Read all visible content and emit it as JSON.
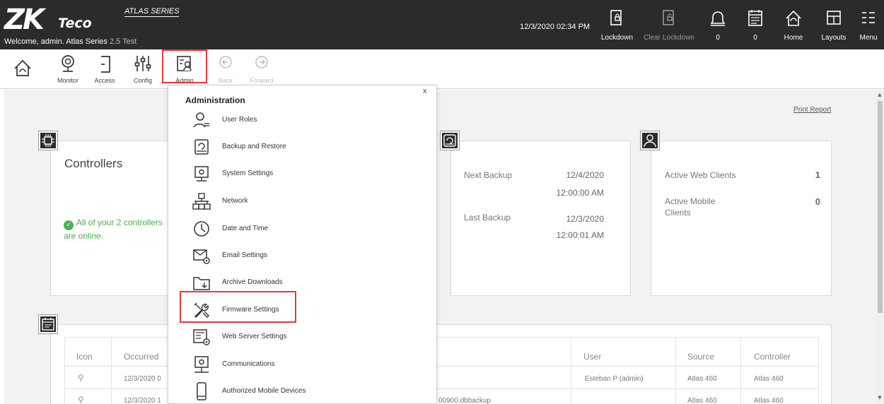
{
  "header": {
    "logo_main": "ZK",
    "logo_sub": "Teco",
    "series_badge": "ATLAS SERIES",
    "welcome_text": "Welcome, admin.  Atlas Series",
    "version_text": "2.5 Test",
    "datetime": "12/3/2020 02:34 PM",
    "buttons": [
      {
        "label": "Lockdown",
        "icon": "lockdown-icon"
      },
      {
        "label": "Clear Lockdown",
        "icon": "clear-lockdown-icon"
      },
      {
        "label": "0",
        "icon": "bell-icon"
      },
      {
        "label": "0",
        "icon": "calendar-icon"
      },
      {
        "label": "Home",
        "icon": "home-icon"
      },
      {
        "label": "Layouts",
        "icon": "layouts-icon"
      },
      {
        "label": "Menu",
        "icon": "menu-icon"
      }
    ]
  },
  "subnav": {
    "items": [
      {
        "label": "Monitor",
        "icon": "monitor-icon"
      },
      {
        "label": "Access",
        "icon": "access-icon"
      },
      {
        "label": "Config",
        "icon": "config-icon"
      },
      {
        "label": "Admin",
        "icon": "admin-icon"
      },
      {
        "label": "Back",
        "icon": "back-arrow-icon"
      },
      {
        "label": "Forward",
        "icon": "forward-arrow-icon"
      }
    ]
  },
  "dashboard": {
    "print_report": "Print Report",
    "controllers": {
      "title": "Controllers",
      "status": "All of your 2 controllers are online."
    },
    "backup": {
      "next_label": "Next Backup",
      "next_date": "12/4/2020",
      "next_time": "12:00:00 AM",
      "last_label": "Last Backup",
      "last_date": "12/3/2020",
      "last_time": "12:00:01 AM"
    },
    "clients": {
      "web_label": "Active Web Clients",
      "web_value": "1",
      "mobile_label": "Active Mobile Clients",
      "mobile_value": "0"
    },
    "events": {
      "columns": [
        "Icon",
        "Occurred",
        "User",
        "Source",
        "Controller"
      ],
      "rows": [
        {
          "occurred": "12/3/2020 0",
          "description": "",
          "user": "Esteban P (admin)",
          "source": "Atlas 460",
          "controller": "Atlas 460"
        },
        {
          "occurred": "12/3/2020 1",
          "description": "00900.dbbackup",
          "user": "",
          "source": "Atlas 460",
          "controller": "Atlas 460"
        }
      ]
    }
  },
  "dropdown": {
    "title": "Administration",
    "close": "x",
    "items": [
      {
        "label": "User Roles",
        "icon": "user-roles-icon"
      },
      {
        "label": "Backup and Restore",
        "icon": "backup-restore-icon"
      },
      {
        "label": "System Settings",
        "icon": "system-settings-icon"
      },
      {
        "label": "Network",
        "icon": "network-icon"
      },
      {
        "label": "Date and Time",
        "icon": "clock-icon"
      },
      {
        "label": "Email Settings",
        "icon": "email-settings-icon"
      },
      {
        "label": "Archive Downloads",
        "icon": "archive-downloads-icon"
      },
      {
        "label": "Firmware Settings",
        "icon": "firmware-settings-icon"
      },
      {
        "label": "Web Server Settings",
        "icon": "web-server-settings-icon"
      },
      {
        "label": "Communications",
        "icon": "communications-icon"
      },
      {
        "label": "Authorized Mobile Devices",
        "icon": "mobile-devices-icon"
      }
    ]
  },
  "colors": {
    "header_bg": "#2b2b2b",
    "highlight": "#e23b3b",
    "success": "#4caf50",
    "content_bg": "#f2f2f2"
  }
}
